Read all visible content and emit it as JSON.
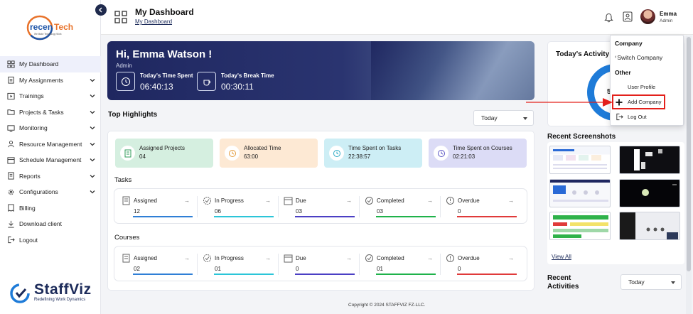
{
  "sidebar": {
    "logo_text": "recenTech",
    "logo_tagline": "We Make Technology Work",
    "items": [
      {
        "label": "My Dashboard",
        "icon": "grid-icon",
        "active": true,
        "expandable": false
      },
      {
        "label": "My Assignments",
        "icon": "clipboard-icon",
        "expandable": true
      },
      {
        "label": "Trainings",
        "icon": "play-icon",
        "expandable": true
      },
      {
        "label": "Projects & Tasks",
        "icon": "folder-icon",
        "expandable": true
      },
      {
        "label": "Monitoring",
        "icon": "monitor-icon",
        "expandable": true
      },
      {
        "label": "Resource Management",
        "icon": "resource-icon",
        "expandable": true
      },
      {
        "label": "Schedule Management",
        "icon": "calendar-icon",
        "expandable": true
      },
      {
        "label": "Reports",
        "icon": "report-icon",
        "expandable": true
      },
      {
        "label": "Configurations",
        "icon": "gear-icon",
        "expandable": true
      },
      {
        "label": "Billing",
        "icon": "billing-icon",
        "expandable": false
      },
      {
        "label": "Download client",
        "icon": "download-icon",
        "expandable": false
      },
      {
        "label": "Logout",
        "icon": "logout-icon",
        "expandable": false
      }
    ],
    "brand_name": "StaffViz",
    "brand_tagline": "Redefining Work Dynamics"
  },
  "header": {
    "title": "My Dashboard",
    "breadcrumb": "My Dashboard",
    "user_name": "Emma",
    "user_role": "Admin"
  },
  "hero": {
    "greeting": "Hi, Emma Watson !",
    "role": "Admin",
    "spent_label": "Today's Time Spent",
    "spent_value": "06:40:13",
    "break_label": "Today's Break Time",
    "break_value": "00:30:11"
  },
  "highlights": {
    "title": "Top Highlights",
    "filter": "Today",
    "cards": [
      {
        "label": "Assigned Projects",
        "value": "04",
        "color": "#d5efe0"
      },
      {
        "label": "Allocated Time",
        "value": "63:00",
        "color": "#fde9d4"
      },
      {
        "label": "Time Spent on Tasks",
        "value": "22:38:57",
        "color": "#cdeef5"
      },
      {
        "label": "Time Spent on Courses",
        "value": "02:21:03",
        "color": "#dcdcf6"
      }
    ]
  },
  "tasks": {
    "title": "Tasks",
    "cells": [
      {
        "label": "Assigned",
        "value": "12",
        "color": "#2f7fd6"
      },
      {
        "label": "In Progress",
        "value": "06",
        "color": "#2bc5d8"
      },
      {
        "label": "Due",
        "value": "03",
        "color": "#4b3fc4"
      },
      {
        "label": "Completed",
        "value": "03",
        "color": "#1fb24a"
      },
      {
        "label": "Overdue",
        "value": "0",
        "color": "#e03a3a"
      }
    ]
  },
  "courses": {
    "title": "Courses",
    "cells": [
      {
        "label": "Assigned",
        "value": "02",
        "color": "#2f7fd6"
      },
      {
        "label": "In Progress",
        "value": "01",
        "color": "#2bc5d8"
      },
      {
        "label": "Due",
        "value": "0",
        "color": "#4b3fc4"
      },
      {
        "label": "Completed",
        "value": "01",
        "color": "#1fb24a"
      },
      {
        "label": "Overdue",
        "value": "0",
        "color": "#e03a3a"
      }
    ]
  },
  "arrow_glyph": "→",
  "footer": "Copyright © 2024 STAFFVIZ FZ-LLC.",
  "right": {
    "activity_title": "Today's Activity L",
    "donut_value": "5",
    "screenshots_title": "Recent Screenshots",
    "view_all": "View All",
    "recent_activities": "Recent Activities",
    "activities_filter": "Today"
  },
  "dropdown": {
    "company_heading": "Company",
    "switch_company": "Switch Company",
    "other_heading": "Other",
    "user_profile": "User Profile",
    "add_company": "Add Company",
    "log_out": "Log Out"
  },
  "colors": {
    "navy": "#1f2760",
    "accent_red": "#e3201b"
  }
}
